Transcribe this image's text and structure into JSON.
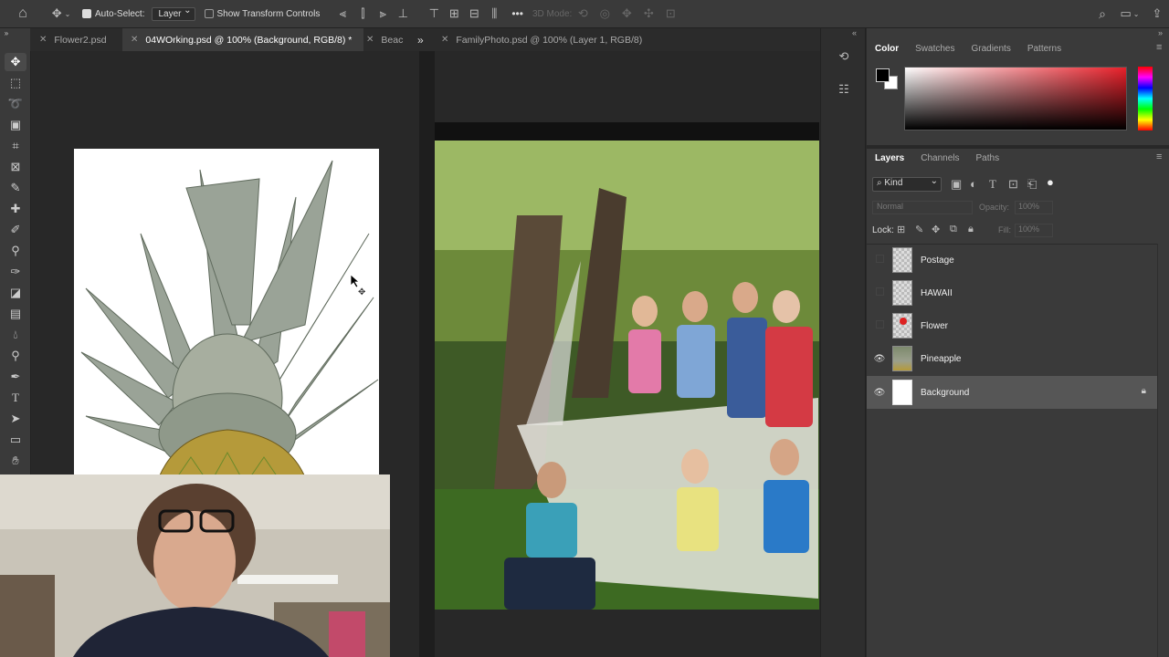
{
  "options_bar": {
    "auto_select_label": "Auto-Select:",
    "auto_select_value": "Layer",
    "show_transform_label": "Show Transform Controls",
    "mode_3d_label": "3D Mode:",
    "more_label": "•••"
  },
  "tabs": [
    {
      "label": "Flower2.psd"
    },
    {
      "label": "04WOrking.psd @ 100% (Background, RGB/8) *"
    },
    {
      "label": "Beac"
    },
    {
      "label": "FamilyPhoto.psd @ 100% (Layer 1, RGB/8)"
    }
  ],
  "color_panel": {
    "tabs": [
      "Color",
      "Swatches",
      "Gradients",
      "Patterns"
    ],
    "active_tab": "Color",
    "foreground_color": "#000000",
    "background_color": "#ffffff",
    "hue_color": "#e8202a"
  },
  "layers_panel": {
    "tabs": [
      "Layers",
      "Channels",
      "Paths"
    ],
    "filter_label": "Kind",
    "blend_mode": "Normal",
    "opacity_label": "Opacity:",
    "opacity_value": "100%",
    "lock_label": "Lock:",
    "fill_label": "Fill:",
    "fill_value": "100%",
    "layers": [
      {
        "name": "Postage",
        "visible": false
      },
      {
        "name": "HAWAII",
        "visible": false
      },
      {
        "name": "Flower",
        "visible": false
      },
      {
        "name": "Pineapple",
        "visible": true
      },
      {
        "name": "Background",
        "visible": true,
        "selected": true,
        "locked": true
      }
    ]
  }
}
